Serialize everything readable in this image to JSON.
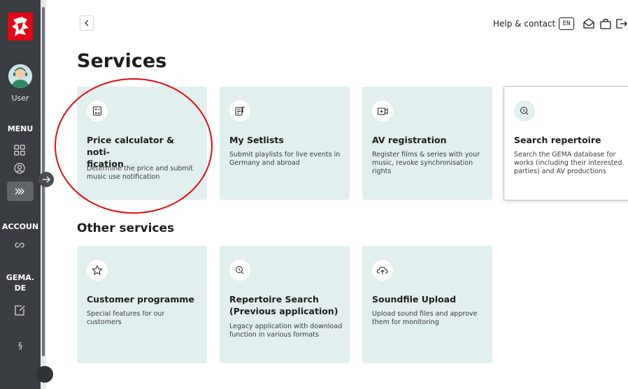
{
  "sidebar": {
    "user_label": "User",
    "menu_label": "MENU",
    "account_label": "ACCOUN",
    "gema_label_1": "GEMA.",
    "gema_label_2": "DE",
    "legal_symbol": "§"
  },
  "topbar": {
    "help_label": "Help & contact",
    "lang_label": "EN"
  },
  "main": {
    "title": "Services",
    "other_title": "Other services",
    "services": [
      {
        "title": "Price calculator & noti-fication",
        "title_1": "Price calculator & noti-",
        "title_2": "fication",
        "desc": "Determine the price and submit music use notification"
      },
      {
        "title": "My Setlists",
        "desc": "Submit playlists for live events in Germany and abroad"
      },
      {
        "title": "AV registration",
        "desc": "Register films & series with your music, revoke synchronisation rights"
      },
      {
        "title": "Search repertoire",
        "desc": "Search the GEMA database for works (including their interested parties) and AV productions"
      }
    ],
    "other_services": [
      {
        "title": "Customer programme",
        "desc": "Special features for our customers"
      },
      {
        "title": "Repertoire Search (Previous application)",
        "desc": "Legacy application with download function in various formats"
      },
      {
        "title": "Soundfile Upload",
        "desc": "Upload sound files and approve them for monitoring"
      }
    ]
  },
  "colors": {
    "sidebar_bg": "#3a3e43",
    "card_bg": "#e1efee",
    "brand_red": "#e30613",
    "annotation_red": "#e20a16"
  },
  "icons": {
    "logo": "gema-logo-icon",
    "back": "chevron-left-icon",
    "mail": "mail-icon",
    "cart": "shopping-bag-icon",
    "logout": "logout-icon"
  }
}
